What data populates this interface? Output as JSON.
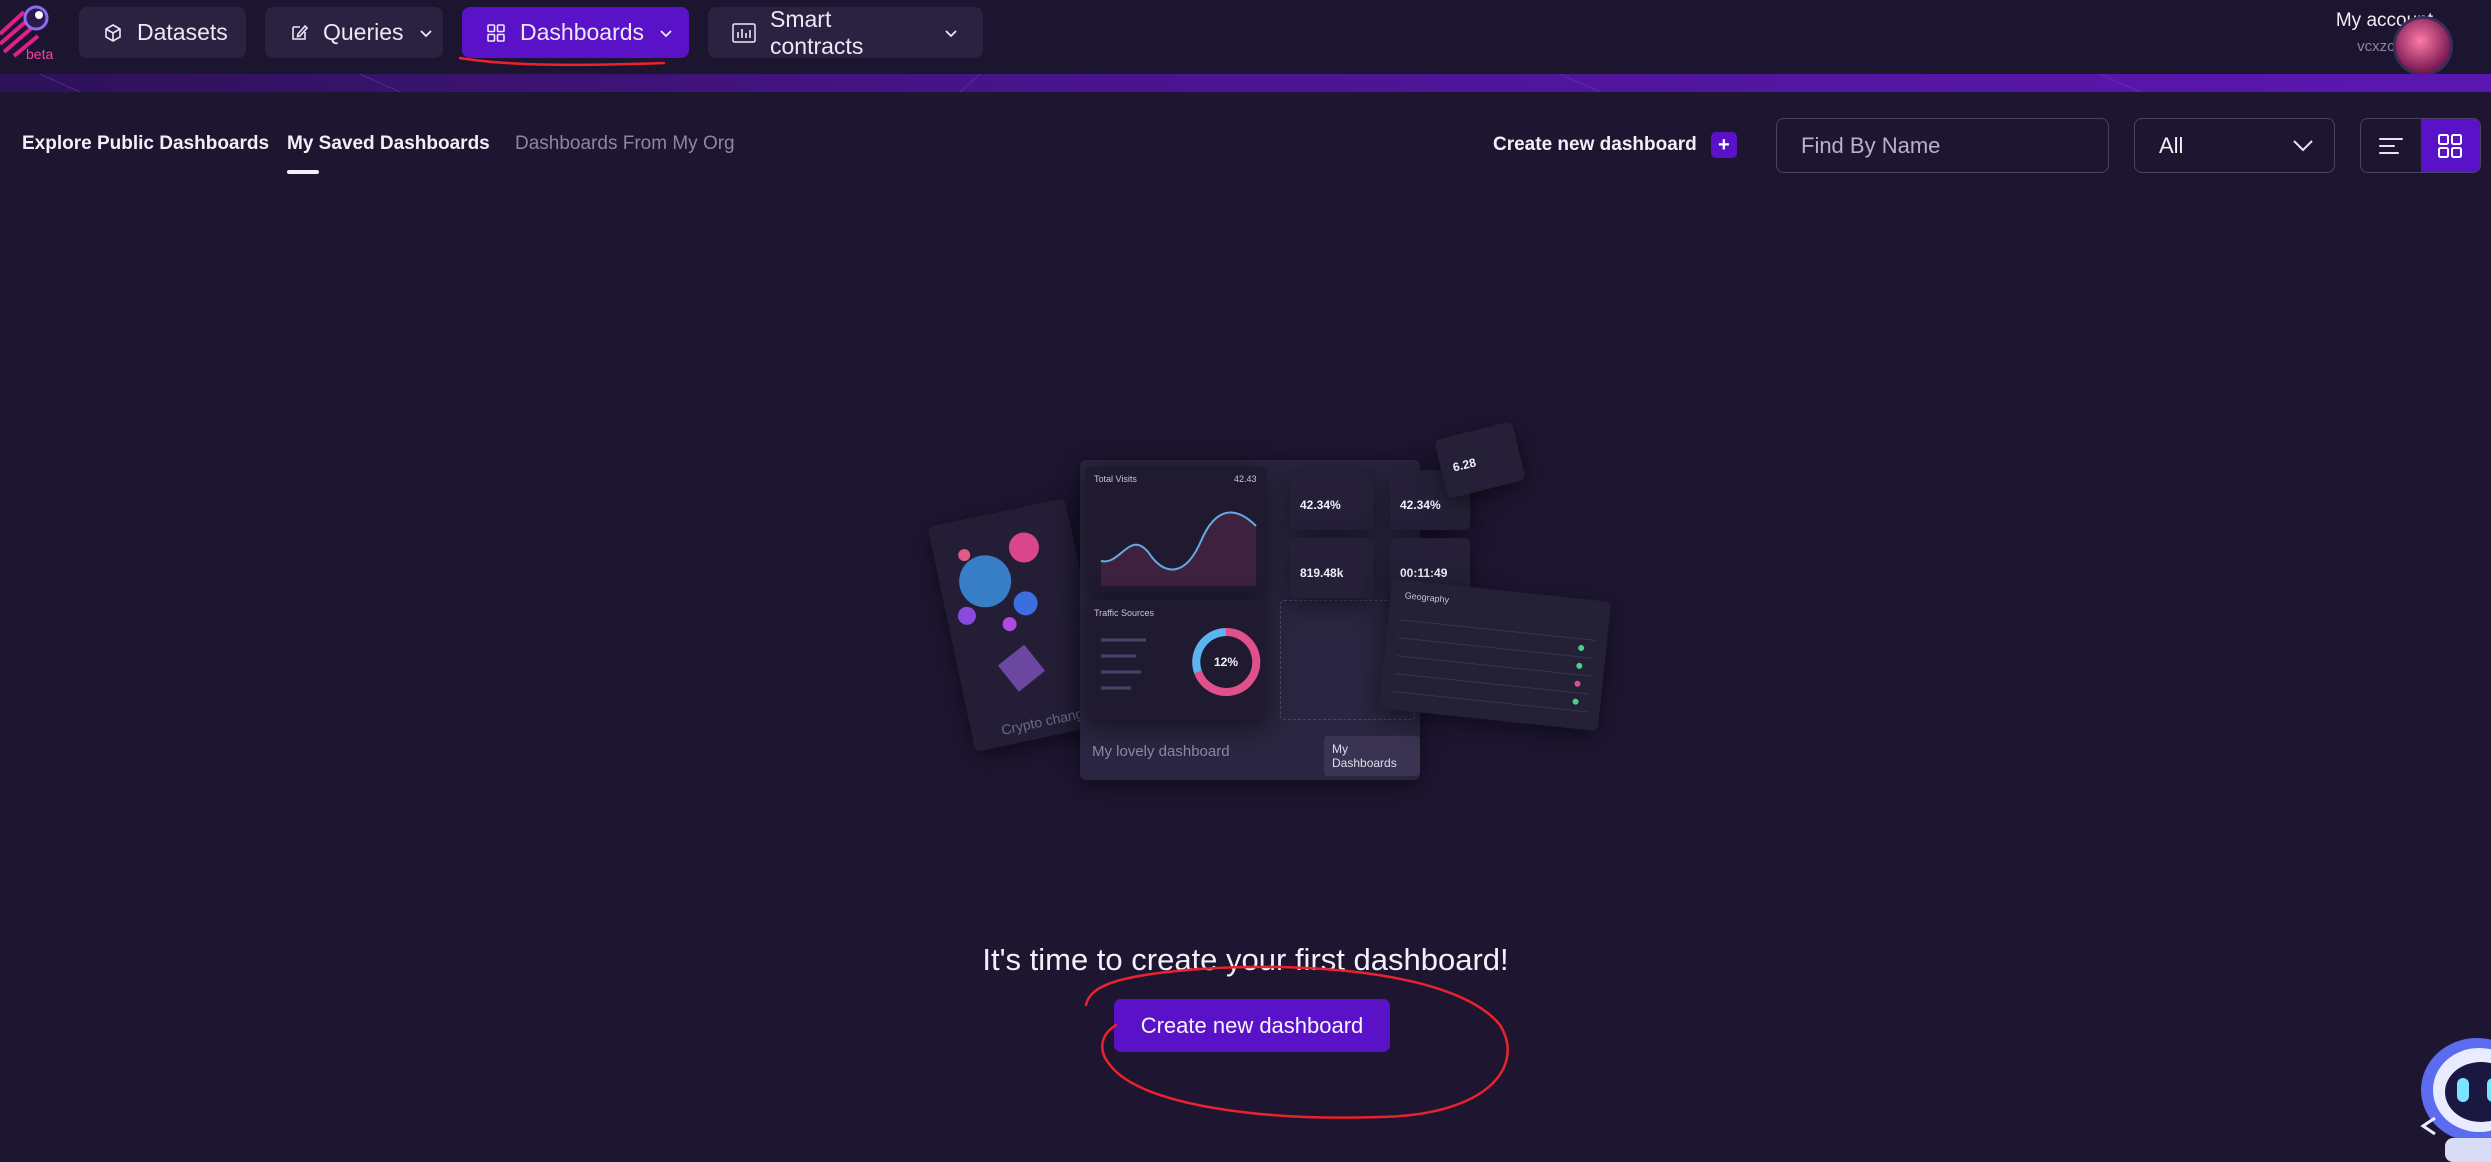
{
  "brand": {
    "badge": "beta"
  },
  "nav": {
    "datasets": "Datasets",
    "queries": "Queries",
    "dashboards": "Dashboards",
    "smart_contracts": "Smart contracts"
  },
  "account": {
    "title": "My account",
    "username": "vcxzcbcvxz"
  },
  "tabs": {
    "explore": "Explore Public Dashboards",
    "saved": "My Saved Dashboards",
    "org": "Dashboards From My Org"
  },
  "toolbar": {
    "create_label": "Create new dashboard",
    "plus": "+",
    "search_placeholder": "Find By Name",
    "filter_value": "All"
  },
  "illustration": {
    "chart_title": "Total Visits",
    "chart_value": "42.43",
    "stat_a": "42.34%",
    "stat_b": "42.34%",
    "stat_c": "819.48k",
    "stat_d": "00:11:49",
    "stat_e": "6.28",
    "traffic_title": "Traffic Sources",
    "donut_value": "12%",
    "geo_title": "Geography",
    "left_label": "Crypto change",
    "dashboard_name": "My lovely dashboard",
    "dashboard_button": "My Dashboards"
  },
  "empty_state": {
    "title": "It's time to create your first dashboard!",
    "cta": "Create new dashboard"
  },
  "colors": {
    "background": "#1e1631",
    "accent": "#5a12c9",
    "annotation": "#e8232e"
  }
}
